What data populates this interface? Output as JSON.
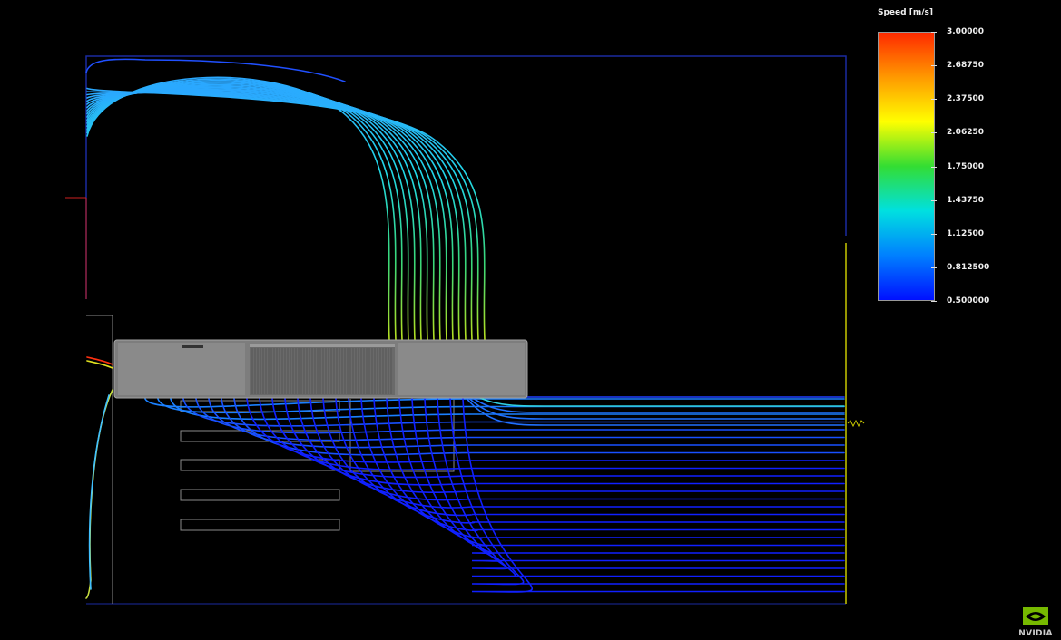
{
  "legend": {
    "title": "Speed [m/s]",
    "ticks": [
      "3.00000",
      "2.68750",
      "2.37500",
      "2.06250",
      "1.75000",
      "1.43750",
      "1.12500",
      "0.812500",
      "0.500000"
    ],
    "range": [
      0.5,
      3.0
    ],
    "colormap": [
      "#ff2a00",
      "#ff9900",
      "#ffff00",
      "#33dd33",
      "#00e0e0",
      "#0080ff",
      "#0010ff"
    ]
  },
  "logo": {
    "text": "NVIDIA",
    "color": "#76b900"
  },
  "colors": {
    "card": "#7d7d7d",
    "outline": "#8a8a8a",
    "boundary": "#1a2aa0",
    "outlet_marker": "#c8c800",
    "inlet_marker": "#cc2020"
  }
}
